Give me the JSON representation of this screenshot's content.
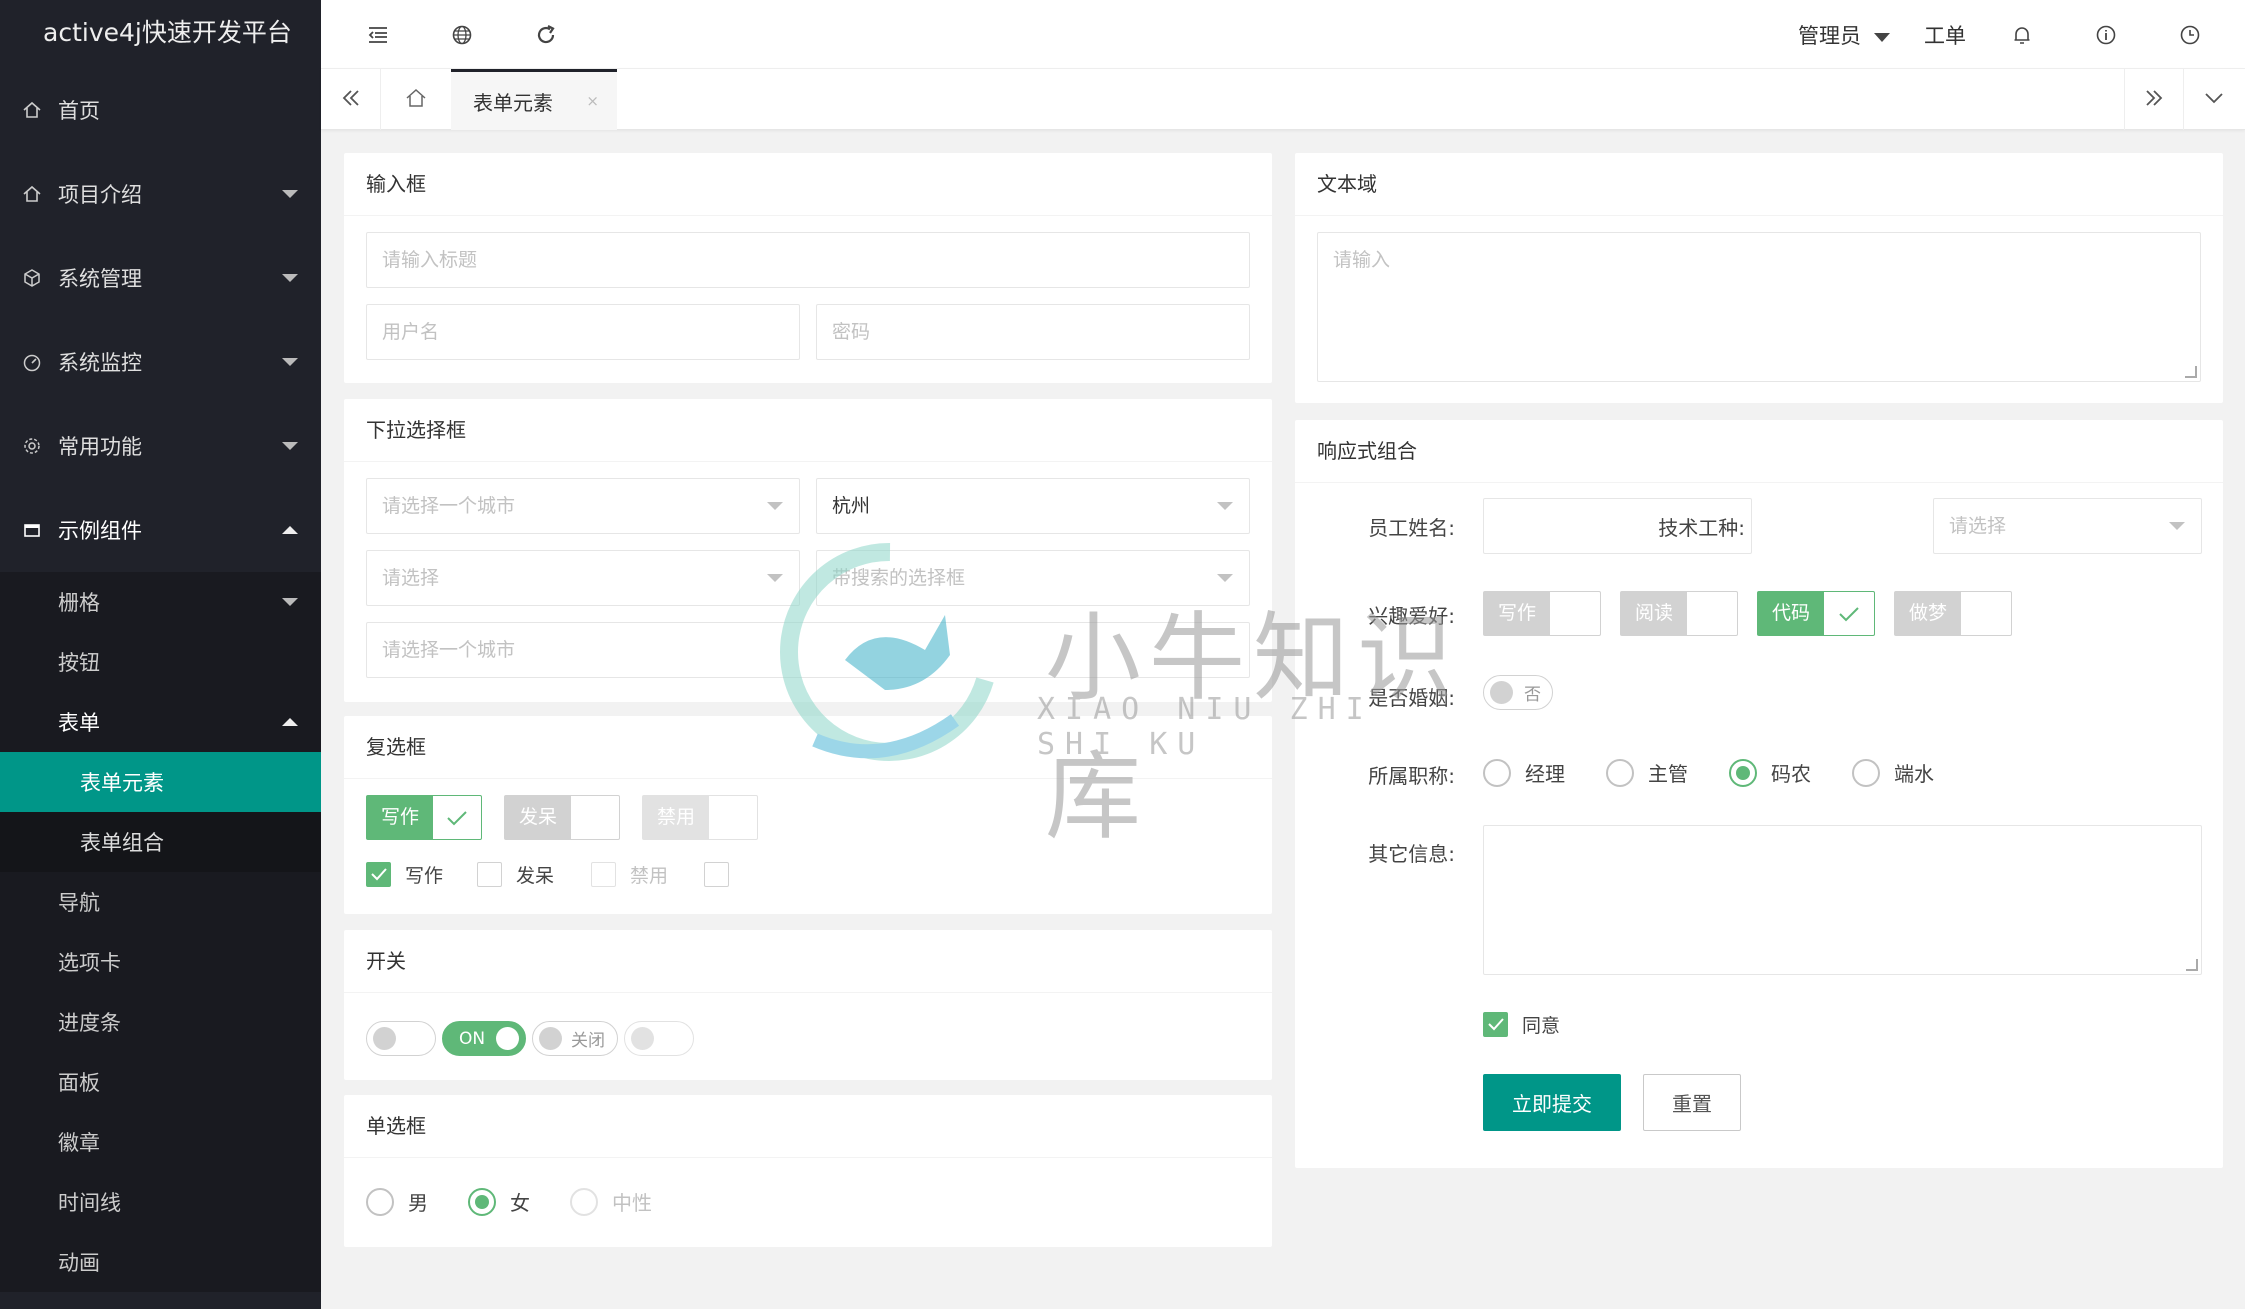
{
  "app": {
    "title": "active4j快速开发平台"
  },
  "sidebar": {
    "items": [
      {
        "label": "首页",
        "icon": "home-icon"
      },
      {
        "label": "项目介绍",
        "icon": "home-icon"
      },
      {
        "label": "系统管理",
        "icon": "cube-icon"
      },
      {
        "label": "系统监控",
        "icon": "dashboard-icon"
      },
      {
        "label": "常用功能",
        "icon": "gear-icon"
      },
      {
        "label": "示例组件",
        "icon": "window-icon"
      }
    ],
    "sub": [
      {
        "label": "栅格"
      },
      {
        "label": "按钮"
      },
      {
        "label": "表单"
      }
    ],
    "form_sub": [
      {
        "label": "表单元素"
      },
      {
        "label": "表单组合"
      }
    ],
    "more": [
      {
        "label": "导航"
      },
      {
        "label": "选项卡"
      },
      {
        "label": "进度条"
      },
      {
        "label": "面板"
      },
      {
        "label": "徽章"
      },
      {
        "label": "时间线"
      },
      {
        "label": "动画"
      }
    ]
  },
  "topbar": {
    "user": "管理员",
    "ticket": "工单"
  },
  "tabs": {
    "active": "表单元素",
    "close": "×"
  },
  "input_card": {
    "title": "输入框",
    "title_placeholder": "请输入标题",
    "username_placeholder": "用户名",
    "password_placeholder": "密码"
  },
  "textarea_card": {
    "title": "文本域",
    "placeholder": "请输入"
  },
  "select_card": {
    "title": "下拉选择框",
    "city_placeholder": "请选择一个城市",
    "city_value": "杭州",
    "select_placeholder": "请选择",
    "search_placeholder": "带搜索的选择框",
    "city_placeholder2": "请选择一个城市"
  },
  "checkbox_card": {
    "title": "复选框",
    "buttons": [
      {
        "label": "写作",
        "checked": true
      },
      {
        "label": "发呆",
        "checked": false
      },
      {
        "label": "禁用",
        "disabled": true
      }
    ],
    "plain": [
      {
        "label": "写作",
        "checked": true
      },
      {
        "label": "发呆",
        "checked": false
      },
      {
        "label": "禁用",
        "disabled": true
      },
      {
        "label": "",
        "checked": false
      }
    ]
  },
  "switch_card": {
    "title": "开关",
    "on_text": "ON",
    "off_text": "关闭"
  },
  "radio_card": {
    "title": "单选框",
    "options": [
      "男",
      "女",
      "中性"
    ],
    "selected": "女"
  },
  "responsive_card": {
    "title": "响应式组合",
    "name_label": "员工姓名:",
    "skill_label": "技术工种:",
    "skill_placeholder": "请选择",
    "hobby_label": "兴趣爱好:",
    "hobbies": [
      {
        "label": "写作",
        "checked": false
      },
      {
        "label": "阅读",
        "checked": false
      },
      {
        "label": "代码",
        "checked": true
      },
      {
        "label": "做梦",
        "checked": false
      }
    ],
    "married_label": "是否婚姻:",
    "married_off": "否",
    "title_label": "所属职称:",
    "titles": [
      "经理",
      "主管",
      "码农",
      "端水"
    ],
    "title_selected": "码农",
    "other_label": "其它信息:",
    "agree": "同意",
    "submit": "立即提交",
    "reset": "重置"
  },
  "watermark": {
    "cn": "小牛知识库",
    "en": "XIAO NIU ZHI SHI KU"
  },
  "colors": {
    "sidebar": "#20222a",
    "accent": "#009688",
    "check": "#5fb878"
  }
}
